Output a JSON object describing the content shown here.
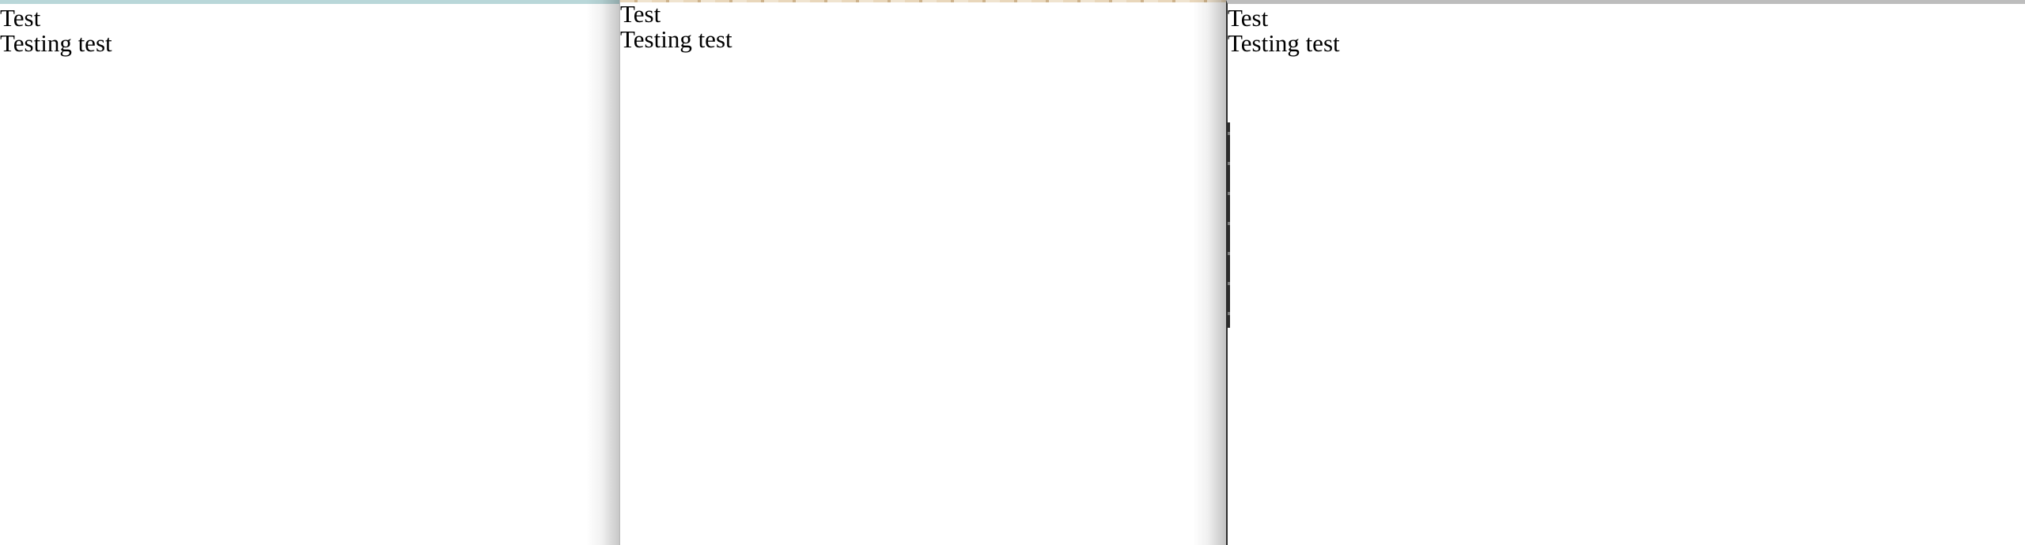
{
  "panes": [
    {
      "title": "Test",
      "body": "Testing test"
    },
    {
      "title": "Test",
      "body": "Testing test"
    },
    {
      "title": "Test",
      "body": "Testing test"
    }
  ]
}
